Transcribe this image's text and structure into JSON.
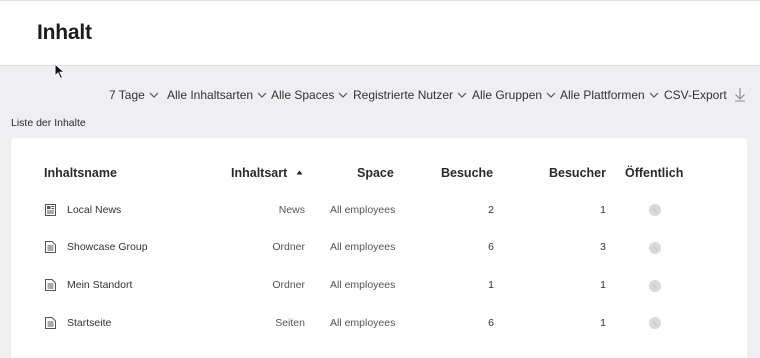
{
  "header": {
    "title": "Inhalt"
  },
  "filters": [
    {
      "label": "7 Tage"
    },
    {
      "label": "Alle Inhaltsarten"
    },
    {
      "label": "Alle Spaces"
    },
    {
      "label": "Registrierte Nutzer"
    },
    {
      "label": "Alle Gruppen"
    },
    {
      "label": "Alle Plattformen"
    }
  ],
  "export": {
    "label": "CSV-Export"
  },
  "list": {
    "title": "Liste der Inhalte"
  },
  "table": {
    "columns": {
      "name": "Inhaltsname",
      "type": "Inhaltsart",
      "space": "Space",
      "visits": "Besuche",
      "visitors": "Besucher",
      "public": "Öffentlich"
    },
    "sort": {
      "column": "type",
      "direction": "ascending"
    },
    "rows": [
      {
        "icon": "news-icon",
        "name": "Local News",
        "type": "News",
        "space": "All employees",
        "visits": "2",
        "visitors": "1",
        "public": false
      },
      {
        "icon": "page-icon",
        "name": "Showcase Group",
        "type": "Ordner",
        "space": "All employees",
        "visits": "6",
        "visitors": "3",
        "public": false
      },
      {
        "icon": "page-icon",
        "name": "Mein Standort",
        "type": "Ordner",
        "space": "All employees",
        "visits": "1",
        "visitors": "1",
        "public": false
      },
      {
        "icon": "page-icon",
        "name": "Startseite",
        "type": "Seiten",
        "space": "All employees",
        "visits": "6",
        "visitors": "1",
        "public": false
      }
    ]
  }
}
